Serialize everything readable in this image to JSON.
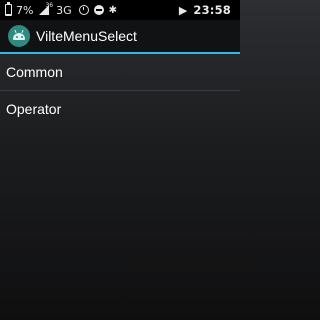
{
  "status_bar": {
    "battery_percent": "7%",
    "network_sup": "36",
    "network_type": "3G",
    "time": "23:58",
    "icons": [
      "battery-icon",
      "signal-icon",
      "alarm-icon",
      "dnd-icon",
      "bluetooth-icon",
      "wifi-icon"
    ]
  },
  "action_bar": {
    "title": "VilteMenuSelect",
    "app_icon": "android-icon",
    "accent_color": "#33b5e5"
  },
  "menu": {
    "items": [
      {
        "label": "Common"
      },
      {
        "label": "Operator"
      }
    ]
  }
}
